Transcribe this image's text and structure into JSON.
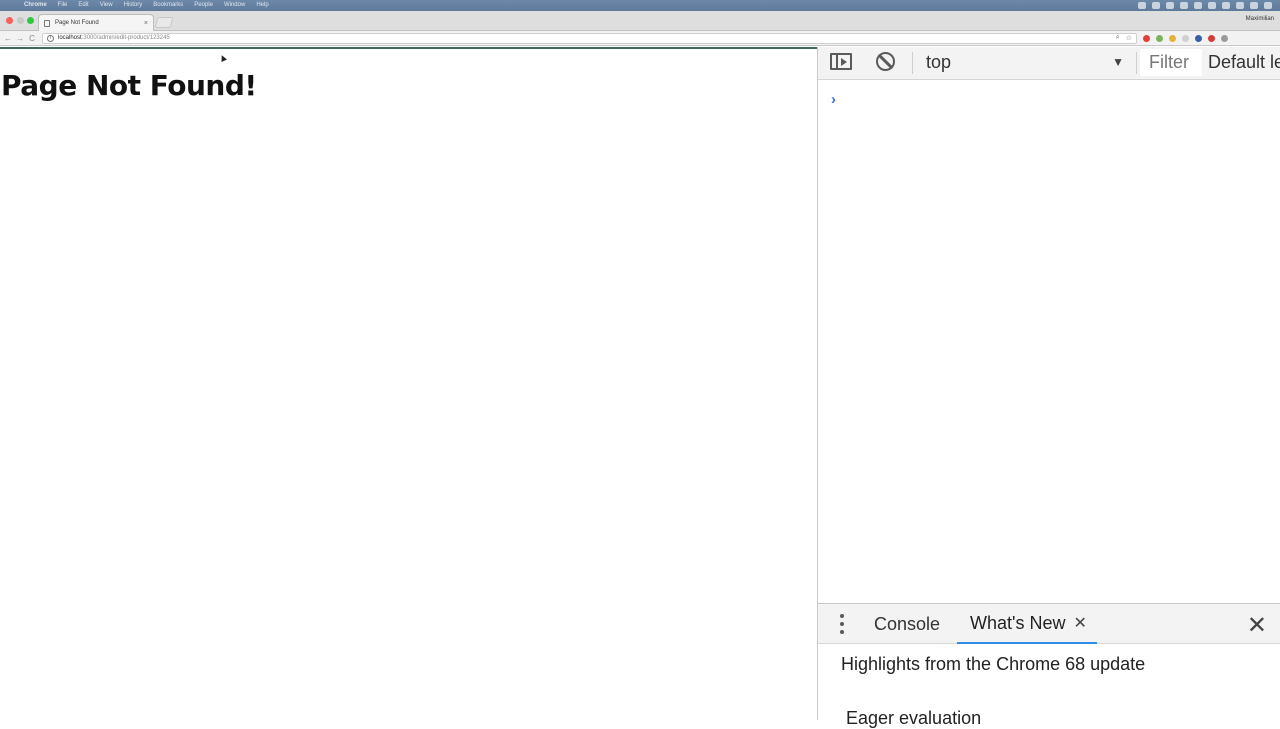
{
  "menubar": {
    "apple": "",
    "items": [
      "Chrome",
      "File",
      "Edit",
      "View",
      "History",
      "Bookmarks",
      "People",
      "Window",
      "Help"
    ],
    "right_text": "Maximilian"
  },
  "tab": {
    "title": "Page Not Found",
    "close": "×"
  },
  "profile": "Maximilian",
  "toolbar": {
    "back": "←",
    "forward": "→",
    "reload": "C",
    "info": "i",
    "url_host": "localhost",
    "url_path": ":3000/admin/edit-product/123245",
    "zoom": "⌕",
    "star": "☆"
  },
  "page": {
    "heading": "Page Not Found!"
  },
  "devtools": {
    "context": "top",
    "context_caret": "▼",
    "filter_label": "Filter",
    "levels_label": "Default le",
    "prompt": "›",
    "drawer": {
      "tab_console": "Console",
      "tab_whats_new": "What's New",
      "tab_close": "✕",
      "close": "✕",
      "highlights": "Highlights from the Chrome 68 update",
      "next_item": "Eager evaluation"
    }
  },
  "colors": {
    "accent_tab_underline": "#2e8ee6",
    "prompt": "#3a72d8"
  }
}
